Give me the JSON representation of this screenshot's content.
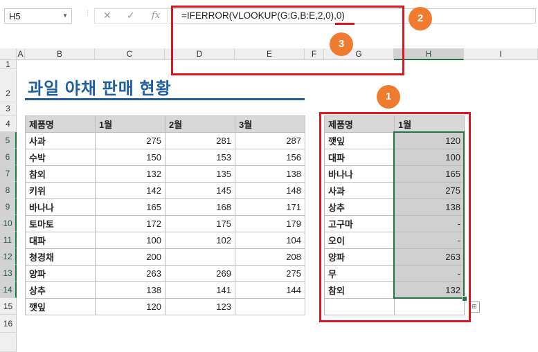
{
  "name_box": "H5",
  "formula_bar": {
    "cancel": "✕",
    "enter": "✓",
    "fx": "fx",
    "formula": "=IFERROR(VLOOKUP(G:G,B:E,2,0),0)"
  },
  "callouts": [
    "1",
    "2",
    "3"
  ],
  "columns": [
    "A",
    "B",
    "C",
    "D",
    "E",
    "F",
    "G",
    "H",
    "I"
  ],
  "rows": [
    "1",
    "2",
    "3",
    "4",
    "5",
    "6",
    "7",
    "8",
    "9",
    "10",
    "11",
    "12",
    "13",
    "14",
    "15",
    "16"
  ],
  "title": "과일 야채 판매 현황",
  "left_table": {
    "headers": [
      "제품명",
      "1월",
      "2월",
      "3월"
    ],
    "rows": [
      [
        "사과",
        "275",
        "281",
        "287"
      ],
      [
        "수박",
        "150",
        "153",
        "156"
      ],
      [
        "참외",
        "132",
        "135",
        "138"
      ],
      [
        "키위",
        "142",
        "145",
        "148"
      ],
      [
        "바나나",
        "165",
        "168",
        "171"
      ],
      [
        "토마토",
        "172",
        "175",
        "179"
      ],
      [
        "대파",
        "100",
        "102",
        "104"
      ],
      [
        "청경채",
        "200",
        "",
        "208"
      ],
      [
        "양파",
        "263",
        "269",
        "275"
      ],
      [
        "상추",
        "138",
        "141",
        "144"
      ],
      [
        "깻잎",
        "120",
        "123",
        ""
      ]
    ]
  },
  "right_table": {
    "headers": [
      "제품명",
      "1월"
    ],
    "rows": [
      [
        "깻잎",
        "120"
      ],
      [
        "대파",
        "100"
      ],
      [
        "바나나",
        "165"
      ],
      [
        "사과",
        "275"
      ],
      [
        "상추",
        "138"
      ],
      [
        "고구마",
        "-"
      ],
      [
        "오이",
        "-"
      ],
      [
        "양파",
        "263"
      ],
      [
        "무",
        "-"
      ],
      [
        "참외",
        "132"
      ],
      [
        "",
        ""
      ]
    ]
  },
  "colors": {
    "callout_red": "#e0151d",
    "badge_orange": "#ef7c2e",
    "title_blue": "#1f5fa0",
    "selection_green": "#217346"
  }
}
